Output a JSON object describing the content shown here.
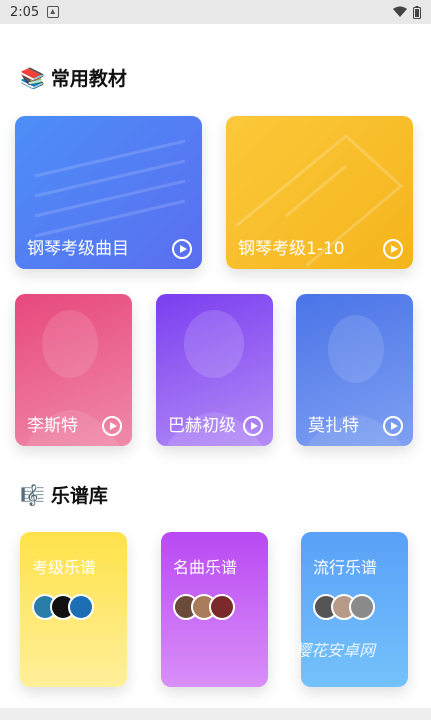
{
  "status_bar": {
    "time": "2:05"
  },
  "sections": {
    "textbooks": {
      "emoji": "📚",
      "title": "常用教材"
    },
    "library": {
      "emoji": "🎼",
      "title": "乐谱库"
    }
  },
  "textbook_cards": [
    {
      "label": "钢琴考级曲目"
    },
    {
      "label": "钢琴考级1-10"
    },
    {
      "label": "李斯特"
    },
    {
      "label": "巴赫初级"
    },
    {
      "label": "莫扎特"
    }
  ],
  "library_cards": [
    {
      "label": "考级乐谱"
    },
    {
      "label": "名曲乐谱"
    },
    {
      "label": "流行乐谱"
    }
  ],
  "watermark": "樱花安卓网",
  "colors": {
    "card_blue": "#4d8ef7",
    "card_yellow": "#fbc93a",
    "card_pink": "#e7487d",
    "card_purple": "#7a3ef0",
    "card_indigo": "#4a74e8",
    "lib_yellow": "#ffe24a",
    "lib_purple": "#b949f3",
    "lib_blue": "#5aa0f8"
  }
}
